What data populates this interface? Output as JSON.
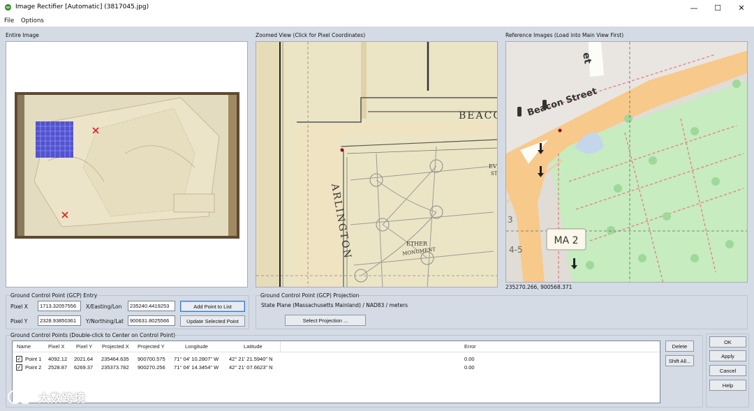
{
  "window": {
    "title": "Image Rectifier [Automatic] (3817045.jpg)",
    "minimize": "—",
    "maximize": "☐",
    "close": "✕"
  },
  "menu": {
    "file": "File",
    "options": "Options"
  },
  "panels": {
    "entire_image": "Entire Image",
    "zoomed_view": "Zoomed View (Click for Pixel Coordinates)",
    "reference_images": "Reference Images (Load into Main View First)",
    "reference_coords": "235270.266, 900568.371"
  },
  "zoom_map": {
    "label_beacon": "BEACO",
    "label_arlington": "ARLINGTON",
    "label_ether": "ETHER",
    "label_monument": "MONUMENT",
    "label_ev": "EV",
    "label_st": "ST"
  },
  "ref_map": {
    "street": "Beacon Street",
    "route": "MA 2",
    "num_3": "3",
    "num_45": "4-5",
    "num_et": "et"
  },
  "gcp_entry": {
    "title": "Ground Control Point (GCP) Entry",
    "pixel_x_label": "Pixel X",
    "pixel_x_value": "1713.32057556",
    "pixel_y_label": "Pixel Y",
    "pixel_y_value": "2328.93850361",
    "easting_label": "X/Easting/Lon",
    "easting_value": "235240.4419253",
    "northing_label": "Y/Northing/Lat",
    "northing_value": "900631.8025566",
    "add_button": "Add Point to List",
    "update_button": "Update Selected Point"
  },
  "gcp_projection": {
    "title": "Ground Control Point (GCP) Projection",
    "projection": "State Plane (Massachusetts Mainland) / NAD83 / meters",
    "select_button": "Select Projection ..."
  },
  "gcp_list": {
    "title": "Ground Control Points (Double-click to Center on Control Point)",
    "columns": [
      "Name",
      "Pixel X",
      "Pixel Y",
      "Projected X",
      "Projected Y",
      "Longitude",
      "Latitude",
      "Error"
    ],
    "rows": [
      {
        "checked": true,
        "name": "Point 1",
        "pixel_x": "4092.12",
        "pixel_y": "2021.64",
        "proj_x": "235464.635",
        "proj_y": "900700.575",
        "lon": "71° 04' 10.2807\" W",
        "lat": "42° 21' 21.5940\" N",
        "error": "0.00"
      },
      {
        "checked": true,
        "name": "Point 2",
        "pixel_x": "2528.87",
        "pixel_y": "6269.37",
        "proj_x": "235373.782",
        "proj_y": "900270.256",
        "lon": "71° 04' 14.3454\" W",
        "lat": "42° 21' 07.6623\" N",
        "error": "0.00"
      }
    ],
    "delete_button": "Delete",
    "shift_all_button": "Shift All..."
  },
  "dialog_buttons": {
    "ok": "OK",
    "apply": "Apply",
    "cancel": "Cancel",
    "help": "Help"
  },
  "watermark": "大数跨境",
  "colors": {
    "accent": "#3b76c6",
    "orange_road": "#f6c98d",
    "park": "#c8ecc0",
    "map_paper": "#efe8c8"
  }
}
